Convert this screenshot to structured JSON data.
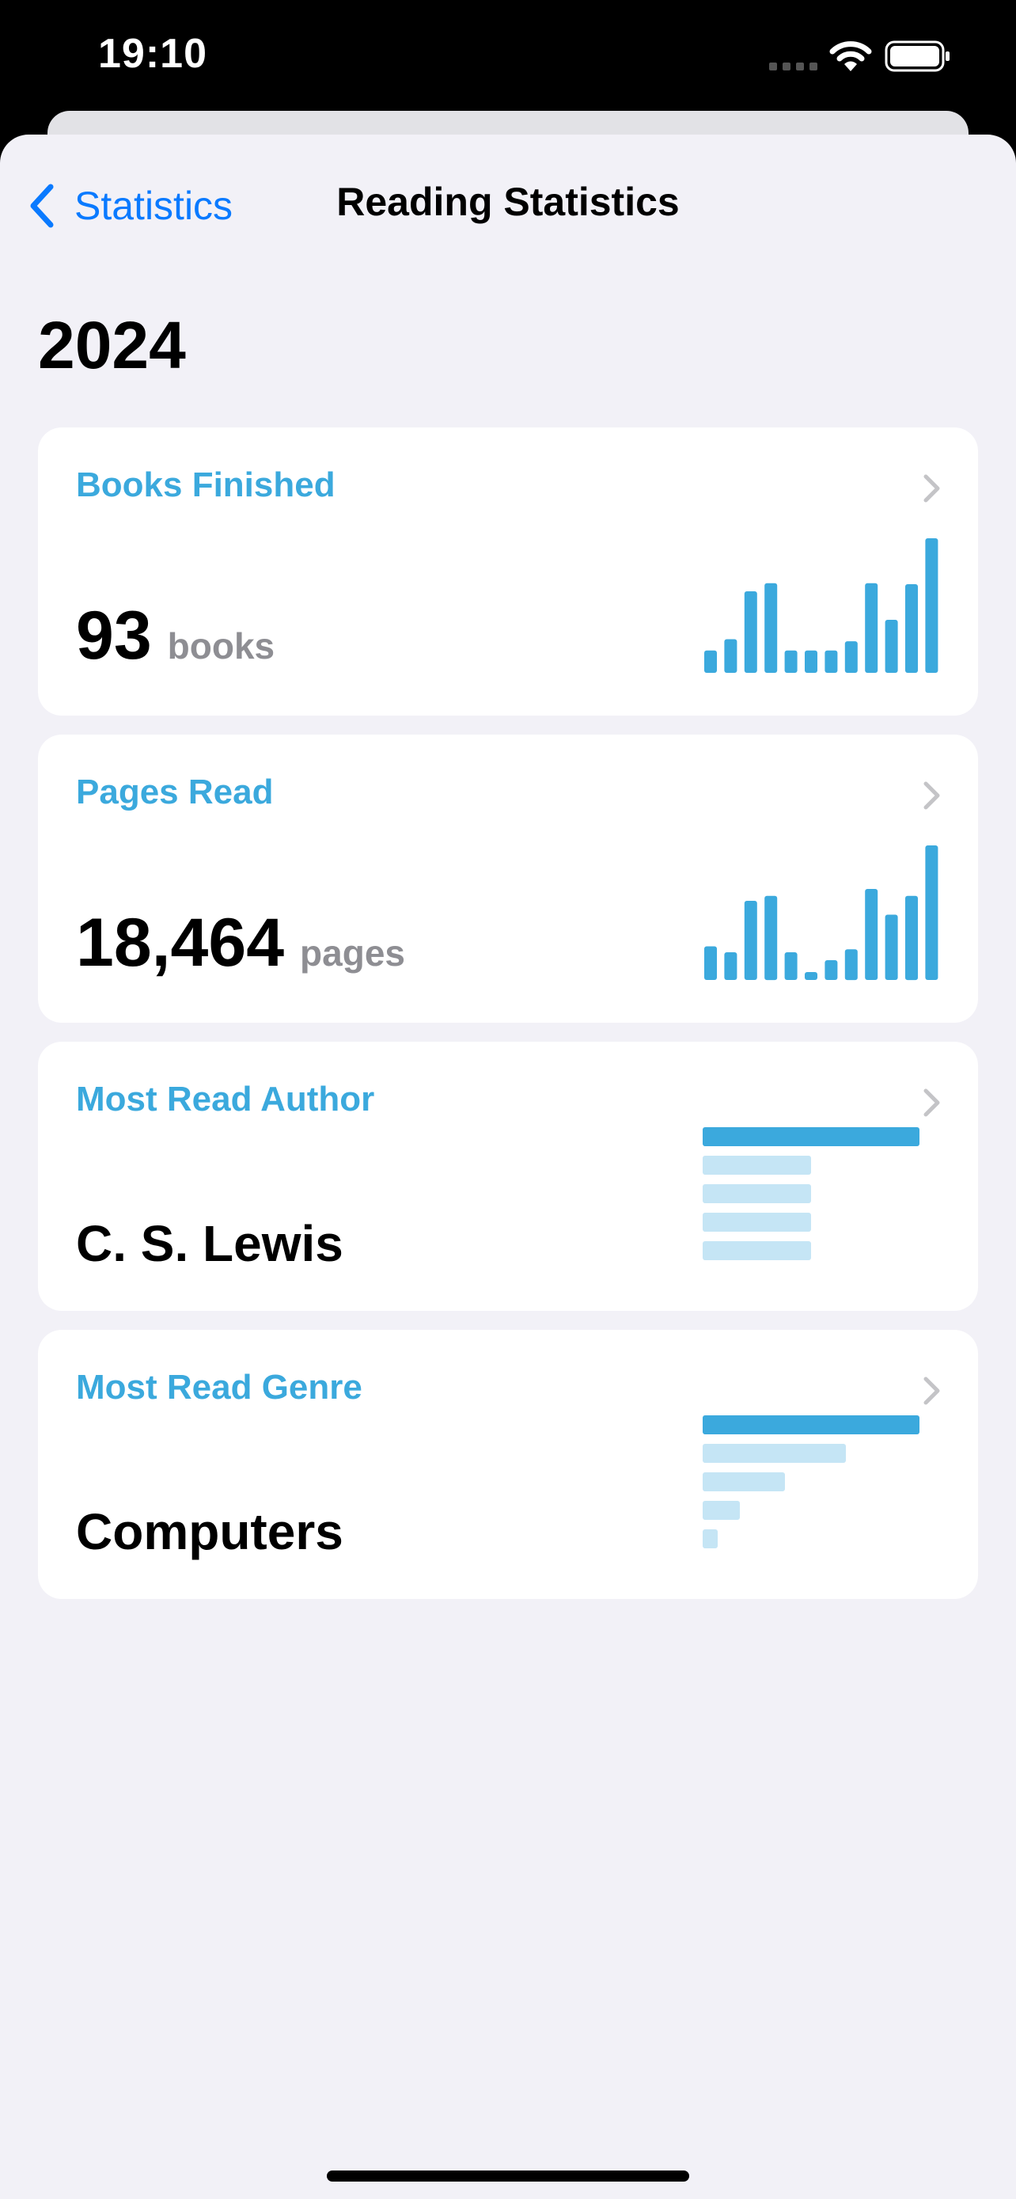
{
  "status_bar": {
    "time": "19:10"
  },
  "nav": {
    "back_label": "Statistics",
    "title": "Reading Statistics"
  },
  "year": "2024",
  "colors": {
    "accent": "#3ba9dd",
    "accent_light": "#c5e5f5",
    "link": "#0a7aff",
    "background": "#f2f1f7"
  },
  "cards": {
    "books_finished": {
      "title": "Books Finished",
      "value": "93",
      "unit": "books",
      "sparkline": [
        2.2,
        3.3,
        8.0,
        8.8,
        2.2,
        2.2,
        2.2,
        3.1,
        8.8,
        5.2,
        8.7,
        13.2
      ]
    },
    "pages_read": {
      "title": "Pages Read",
      "value": "18,464",
      "unit": "pages",
      "sparkline": [
        3.4,
        2.8,
        8.0,
        8.5,
        2.8,
        0.8,
        2.0,
        3.1,
        9.2,
        6.6,
        8.5,
        13.6
      ]
    },
    "most_read_author": {
      "title": "Most Read Author",
      "value": "C. S. Lewis",
      "ranking": [
        1.0,
        0.5,
        0.5,
        0.5,
        0.5
      ]
    },
    "most_read_genre": {
      "title": "Most Read Genre",
      "value": "Computers",
      "ranking": [
        1.0,
        0.66,
        0.38,
        0.17,
        0.07
      ]
    }
  }
}
